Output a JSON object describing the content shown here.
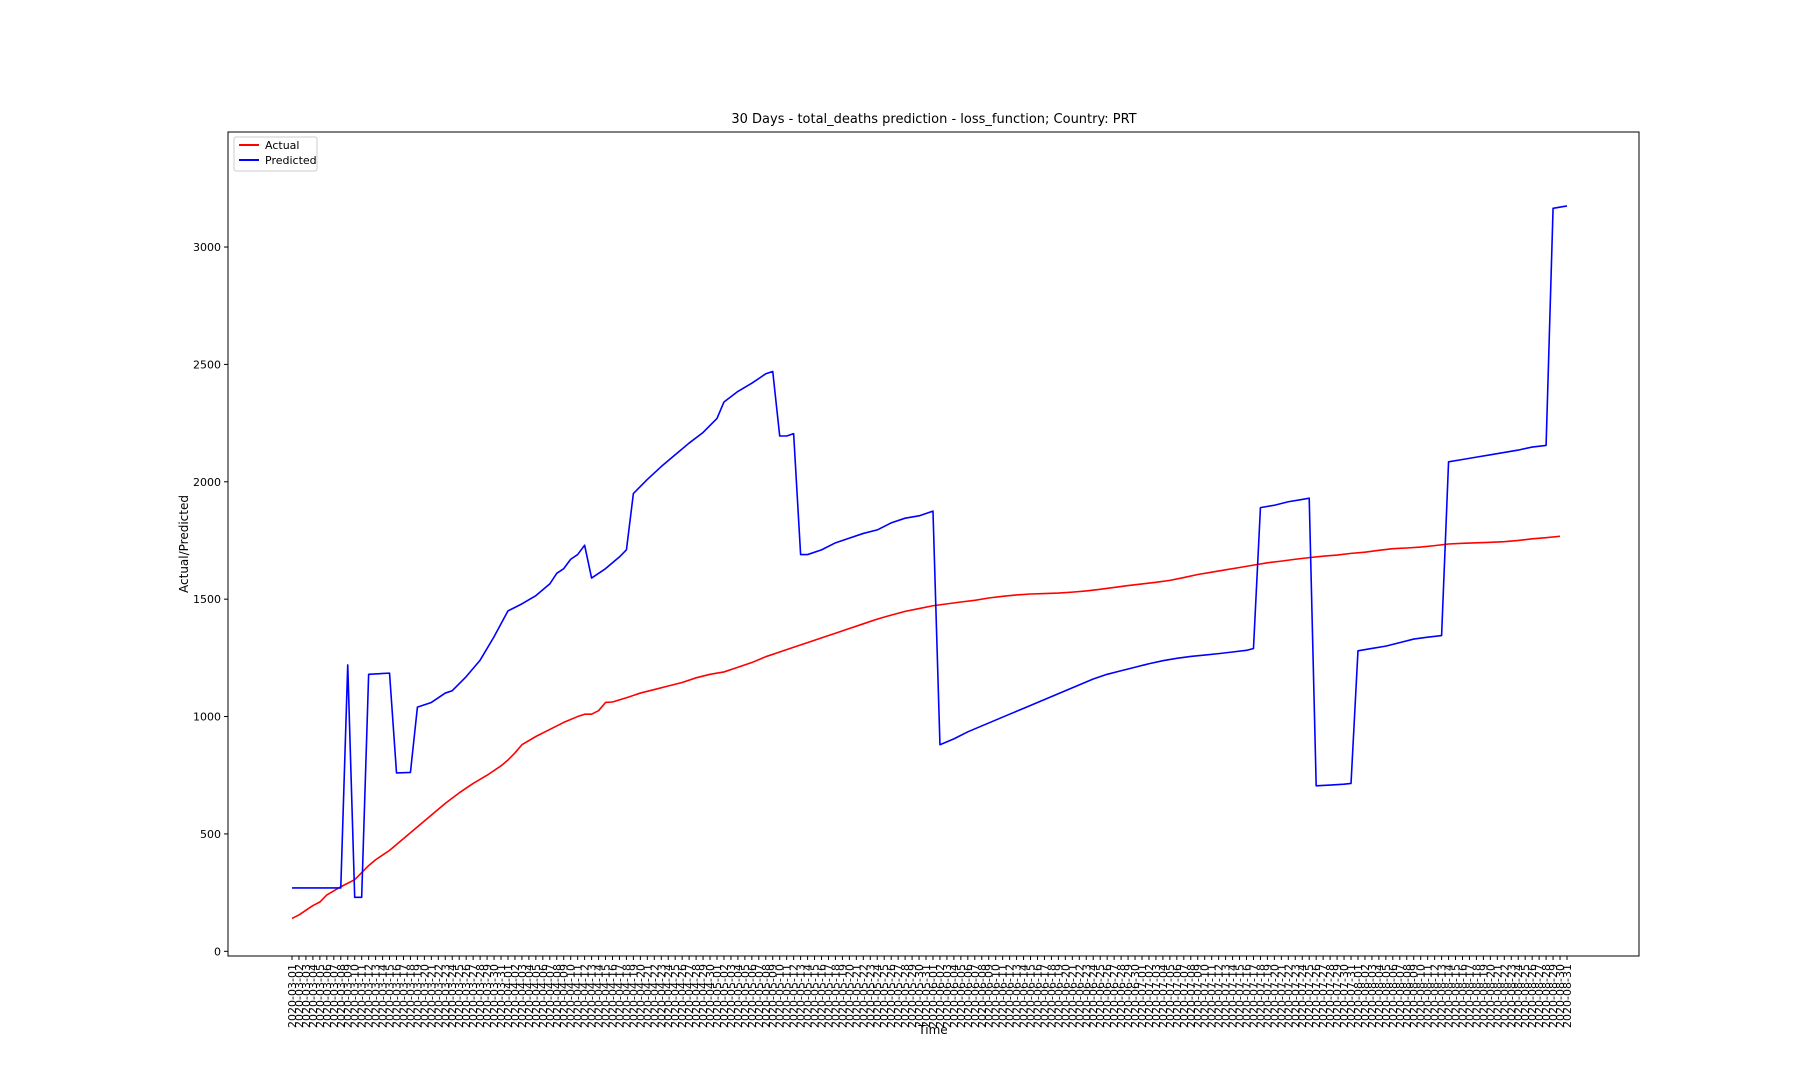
{
  "chart_data": {
    "type": "line",
    "title": "30 Days - total_deaths prediction - loss_function; Country: PRT",
    "xlabel": "Time",
    "ylabel": "Actual/Predicted",
    "x_start": "2020-03-01",
    "x_end": "2020-08-31",
    "ylim": [
      -20,
      3490
    ],
    "yticks": [
      0,
      500,
      1000,
      1500,
      2000,
      2500,
      3000
    ],
    "legend_position": "top-left",
    "grid": false,
    "series": [
      {
        "name": "Actual",
        "color": "#ff0000",
        "points": [
          [
            "2020-03-01",
            140
          ],
          [
            "2020-03-02",
            155
          ],
          [
            "2020-03-04",
            195
          ],
          [
            "2020-03-05",
            210
          ],
          [
            "2020-03-06",
            240
          ],
          [
            "2020-03-08",
            275
          ],
          [
            "2020-03-09",
            290
          ],
          [
            "2020-03-10",
            305
          ],
          [
            "2020-03-12",
            365
          ],
          [
            "2020-03-13",
            390
          ],
          [
            "2020-03-14",
            410
          ],
          [
            "2020-03-15",
            430
          ],
          [
            "2020-03-17",
            480
          ],
          [
            "2020-03-19",
            530
          ],
          [
            "2020-03-21",
            580
          ],
          [
            "2020-03-23",
            630
          ],
          [
            "2020-03-25",
            675
          ],
          [
            "2020-03-27",
            715
          ],
          [
            "2020-03-29",
            750
          ],
          [
            "2020-03-31",
            790
          ],
          [
            "2020-04-01",
            815
          ],
          [
            "2020-04-02",
            845
          ],
          [
            "2020-04-03",
            880
          ],
          [
            "2020-04-05",
            915
          ],
          [
            "2020-04-07",
            945
          ],
          [
            "2020-04-09",
            975
          ],
          [
            "2020-04-11",
            1000
          ],
          [
            "2020-04-12",
            1010
          ],
          [
            "2020-04-13",
            1010
          ],
          [
            "2020-04-14",
            1025
          ],
          [
            "2020-04-15",
            1060
          ],
          [
            "2020-04-16",
            1062
          ],
          [
            "2020-04-18",
            1080
          ],
          [
            "2020-04-20",
            1100
          ],
          [
            "2020-04-22",
            1115
          ],
          [
            "2020-04-24",
            1130
          ],
          [
            "2020-04-26",
            1145
          ],
          [
            "2020-04-28",
            1165
          ],
          [
            "2020-04-30",
            1180
          ],
          [
            "2020-05-02",
            1190
          ],
          [
            "2020-05-04",
            1210
          ],
          [
            "2020-05-06",
            1230
          ],
          [
            "2020-05-08",
            1255
          ],
          [
            "2020-05-10",
            1275
          ],
          [
            "2020-05-12",
            1295
          ],
          [
            "2020-05-14",
            1315
          ],
          [
            "2020-05-16",
            1335
          ],
          [
            "2020-05-18",
            1355
          ],
          [
            "2020-05-20",
            1375
          ],
          [
            "2020-05-22",
            1395
          ],
          [
            "2020-05-24",
            1415
          ],
          [
            "2020-05-26",
            1432
          ],
          [
            "2020-05-28",
            1448
          ],
          [
            "2020-05-30",
            1460
          ],
          [
            "2020-06-01",
            1472
          ],
          [
            "2020-06-03",
            1480
          ],
          [
            "2020-06-05",
            1488
          ],
          [
            "2020-06-07",
            1495
          ],
          [
            "2020-06-09",
            1505
          ],
          [
            "2020-06-11",
            1512
          ],
          [
            "2020-06-13",
            1518
          ],
          [
            "2020-06-15",
            1522
          ],
          [
            "2020-06-17",
            1524
          ],
          [
            "2020-06-19",
            1526
          ],
          [
            "2020-06-21",
            1530
          ],
          [
            "2020-06-23",
            1535
          ],
          [
            "2020-06-25",
            1542
          ],
          [
            "2020-06-27",
            1550
          ],
          [
            "2020-06-29",
            1558
          ],
          [
            "2020-07-01",
            1565
          ],
          [
            "2020-07-03",
            1572
          ],
          [
            "2020-07-05",
            1580
          ],
          [
            "2020-07-07",
            1592
          ],
          [
            "2020-07-09",
            1605
          ],
          [
            "2020-07-11",
            1615
          ],
          [
            "2020-07-13",
            1625
          ],
          [
            "2020-07-15",
            1635
          ],
          [
            "2020-07-17",
            1645
          ],
          [
            "2020-07-19",
            1655
          ],
          [
            "2020-07-21",
            1662
          ],
          [
            "2020-07-23",
            1670
          ],
          [
            "2020-07-25",
            1677
          ],
          [
            "2020-07-27",
            1683
          ],
          [
            "2020-07-29",
            1688
          ],
          [
            "2020-07-31",
            1695
          ],
          [
            "2020-08-02",
            1700
          ],
          [
            "2020-08-04",
            1708
          ],
          [
            "2020-08-06",
            1715
          ],
          [
            "2020-08-08",
            1718
          ],
          [
            "2020-08-10",
            1722
          ],
          [
            "2020-08-12",
            1728
          ],
          [
            "2020-08-14",
            1735
          ],
          [
            "2020-08-16",
            1738
          ],
          [
            "2020-08-18",
            1740
          ],
          [
            "2020-08-20",
            1742
          ],
          [
            "2020-08-22",
            1745
          ],
          [
            "2020-08-24",
            1750
          ],
          [
            "2020-08-26",
            1757
          ],
          [
            "2020-08-28",
            1762
          ],
          [
            "2020-08-30",
            1768
          ]
        ]
      },
      {
        "name": "Predicted",
        "color": "#0000ff",
        "points": [
          [
            "2020-03-01",
            270
          ],
          [
            "2020-03-08",
            270
          ],
          [
            "2020-03-09",
            1220
          ],
          [
            "2020-03-10",
            230
          ],
          [
            "2020-03-11",
            230
          ],
          [
            "2020-03-12",
            1180
          ],
          [
            "2020-03-15",
            1185
          ],
          [
            "2020-03-16",
            760
          ],
          [
            "2020-03-18",
            762
          ],
          [
            "2020-03-19",
            1040
          ],
          [
            "2020-03-21",
            1060
          ],
          [
            "2020-03-23",
            1100
          ],
          [
            "2020-03-24",
            1110
          ],
          [
            "2020-03-26",
            1170
          ],
          [
            "2020-03-28",
            1240
          ],
          [
            "2020-03-30",
            1340
          ],
          [
            "2020-04-01",
            1450
          ],
          [
            "2020-04-03",
            1480
          ],
          [
            "2020-04-05",
            1515
          ],
          [
            "2020-04-07",
            1565
          ],
          [
            "2020-04-08",
            1610
          ],
          [
            "2020-04-09",
            1630
          ],
          [
            "2020-04-10",
            1670
          ],
          [
            "2020-04-11",
            1690
          ],
          [
            "2020-04-12",
            1730
          ],
          [
            "2020-04-13",
            1590
          ],
          [
            "2020-04-15",
            1630
          ],
          [
            "2020-04-17",
            1680
          ],
          [
            "2020-04-18",
            1710
          ],
          [
            "2020-04-19",
            1950
          ],
          [
            "2020-04-21",
            2010
          ],
          [
            "2020-04-23",
            2065
          ],
          [
            "2020-04-25",
            2115
          ],
          [
            "2020-04-27",
            2165
          ],
          [
            "2020-04-29",
            2210
          ],
          [
            "2020-04-30",
            2240
          ],
          [
            "2020-05-01",
            2270
          ],
          [
            "2020-05-02",
            2340
          ],
          [
            "2020-05-04",
            2385
          ],
          [
            "2020-05-06",
            2420
          ],
          [
            "2020-05-08",
            2460
          ],
          [
            "2020-05-09",
            2470
          ],
          [
            "2020-05-10",
            2195
          ],
          [
            "2020-05-11",
            2195
          ],
          [
            "2020-05-12",
            2205
          ],
          [
            "2020-05-13",
            1690
          ],
          [
            "2020-05-14",
            1690
          ],
          [
            "2020-05-16",
            1710
          ],
          [
            "2020-05-18",
            1740
          ],
          [
            "2020-05-20",
            1760
          ],
          [
            "2020-05-22",
            1780
          ],
          [
            "2020-05-24",
            1795
          ],
          [
            "2020-05-26",
            1825
          ],
          [
            "2020-05-28",
            1845
          ],
          [
            "2020-05-30",
            1855
          ],
          [
            "2020-06-01",
            1875
          ],
          [
            "2020-06-02",
            880
          ],
          [
            "2020-06-04",
            905
          ],
          [
            "2020-06-06",
            935
          ],
          [
            "2020-06-08",
            960
          ],
          [
            "2020-06-10",
            985
          ],
          [
            "2020-06-12",
            1010
          ],
          [
            "2020-06-14",
            1035
          ],
          [
            "2020-06-16",
            1060
          ],
          [
            "2020-06-18",
            1085
          ],
          [
            "2020-06-20",
            1110
          ],
          [
            "2020-06-22",
            1135
          ],
          [
            "2020-06-24",
            1160
          ],
          [
            "2020-06-26",
            1180
          ],
          [
            "2020-06-28",
            1195
          ],
          [
            "2020-06-30",
            1210
          ],
          [
            "2020-07-02",
            1225
          ],
          [
            "2020-07-04",
            1238
          ],
          [
            "2020-07-06",
            1248
          ],
          [
            "2020-07-08",
            1256
          ],
          [
            "2020-07-10",
            1262
          ],
          [
            "2020-07-12",
            1268
          ],
          [
            "2020-07-14",
            1275
          ],
          [
            "2020-07-16",
            1282
          ],
          [
            "2020-07-17",
            1290
          ],
          [
            "2020-07-18",
            1890
          ],
          [
            "2020-07-20",
            1900
          ],
          [
            "2020-07-22",
            1915
          ],
          [
            "2020-07-24",
            1925
          ],
          [
            "2020-07-25",
            1930
          ],
          [
            "2020-07-26",
            705
          ],
          [
            "2020-07-28",
            708
          ],
          [
            "2020-07-30",
            712
          ],
          [
            "2020-07-31",
            715
          ],
          [
            "2020-08-01",
            1280
          ],
          [
            "2020-08-03",
            1290
          ],
          [
            "2020-08-05",
            1300
          ],
          [
            "2020-08-07",
            1315
          ],
          [
            "2020-08-09",
            1330
          ],
          [
            "2020-08-11",
            1338
          ],
          [
            "2020-08-13",
            1345
          ],
          [
            "2020-08-14",
            2085
          ],
          [
            "2020-08-16",
            2095
          ],
          [
            "2020-08-18",
            2105
          ],
          [
            "2020-08-20",
            2115
          ],
          [
            "2020-08-22",
            2125
          ],
          [
            "2020-08-24",
            2135
          ],
          [
            "2020-08-26",
            2148
          ],
          [
            "2020-08-28",
            2155
          ],
          [
            "2020-08-29",
            3165
          ],
          [
            "2020-08-31",
            3175
          ]
        ]
      }
    ]
  }
}
